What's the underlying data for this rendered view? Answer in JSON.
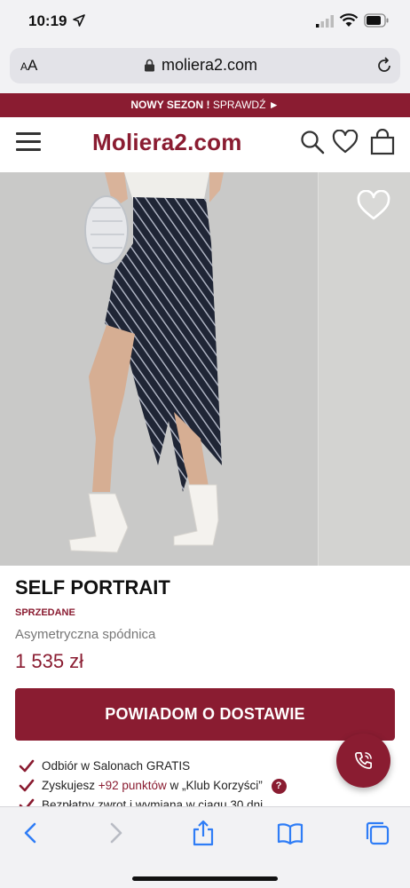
{
  "status": {
    "time": "10:19"
  },
  "browser": {
    "text_size_label_small": "A",
    "text_size_label_big": "A",
    "url": "moliera2.com"
  },
  "promo": {
    "bold": "NOWY SEZON !",
    "link": "SPRAWDŹ ►"
  },
  "header": {
    "logo": "Moliera2.com"
  },
  "product": {
    "brand": "SELF PORTRAIT",
    "status": "SPRZEDANE",
    "name": "Asymetryczna spódnica",
    "price": "1 535 zł",
    "notify_button": "POWIADOM O DOSTAWIE"
  },
  "benefits": [
    {
      "text": "Odbiór w Salonach GRATIS"
    },
    {
      "pre": "Zyskujesz ",
      "accent": "+92 punktów",
      "post": " w „Klub Korzyści”",
      "help": "?"
    },
    {
      "text": "Bezpłatny zwrot i wymiana w ciągu 30 dni"
    }
  ],
  "colors": {
    "brand": "#8a1c31",
    "photo_bg": "#c9c9c8",
    "skirt": "#1f2535"
  },
  "icons": [
    "location-arrow-icon",
    "signal-icon",
    "wifi-icon",
    "battery-icon",
    "lock-icon",
    "reload-icon",
    "menu-icon",
    "search-icon",
    "heart-icon",
    "bag-icon",
    "wishlist-heart-icon",
    "check-icon",
    "phone-icon",
    "back-icon",
    "forward-icon",
    "share-icon",
    "bookmarks-icon",
    "tabs-icon"
  ]
}
